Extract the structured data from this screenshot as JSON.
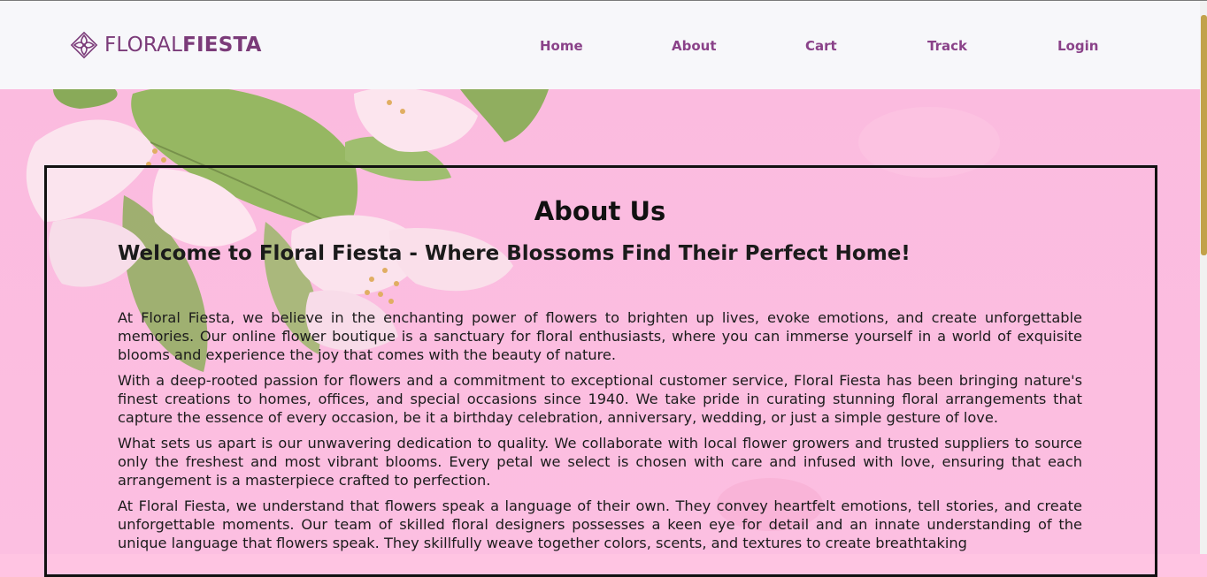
{
  "brand": {
    "part1": "FLORAL",
    "part2": "FIESTA",
    "icon": "flower-logo-icon",
    "color": "#7b3b79"
  },
  "nav": {
    "home": "Home",
    "about": "About",
    "cart": "Cart",
    "track": "Track",
    "login": "Login"
  },
  "about": {
    "title": "About Us",
    "welcome": "Welcome to Floral Fiesta - Where Blossoms Find Their Perfect Home!",
    "paragraphs": [
      "At Floral Fiesta, we believe in the enchanting power of flowers to brighten up lives, evoke emotions, and create unforgettable memories. Our online flower boutique is a sanctuary for floral enthusiasts, where you can immerse yourself in a world of exquisite blooms and experience the joy that comes with the beauty of nature.",
      "With a deep-rooted passion for flowers and a commitment to exceptional customer service, Floral Fiesta has been bringing nature's finest creations to homes, offices, and special occasions since 1940. We take pride in curating stunning floral arrangements that capture the essence of every occasion, be it a birthday celebration, anniversary, wedding, or just a simple gesture of love.",
      "What sets us apart is our unwavering dedication to quality. We collaborate with local flower growers and trusted suppliers to source only the freshest and most vibrant blooms. Every petal we select is chosen with care and infused with love, ensuring that each arrangement is a masterpiece crafted to perfection.",
      "At Floral Fiesta, we understand that flowers speak a language of their own. They convey heartfelt emotions, tell stories, and create unforgettable moments. Our team of skilled floral designers possesses a keen eye for detail and an innate understanding of the unique language that flowers speak. They skillfully weave together colors, scents, and textures to create breathtaking"
    ]
  },
  "colors": {
    "nav_text": "#8a4289",
    "hero_bg": "#fbc3e2",
    "header_bg": "#f7f7fa"
  }
}
